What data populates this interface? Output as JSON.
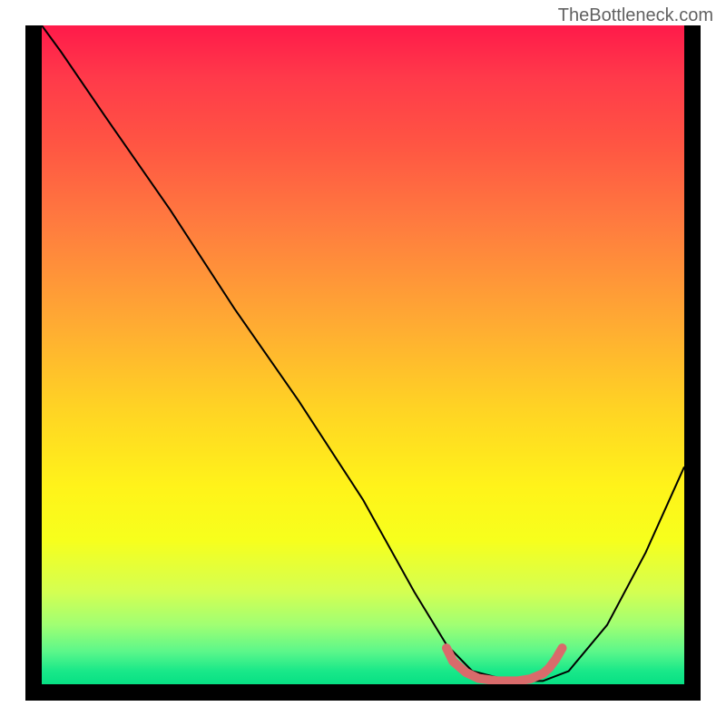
{
  "watermark": "TheBottleneck.com",
  "chart_data": {
    "type": "line",
    "title": "",
    "xlabel": "",
    "ylabel": "",
    "xlim": [
      0,
      100
    ],
    "ylim": [
      0,
      100
    ],
    "series": [
      {
        "name": "bottleneck-curve",
        "color": "#000000",
        "x": [
          0,
          3,
          10,
          20,
          30,
          40,
          50,
          58,
          63,
          67,
          73,
          78,
          82,
          88,
          94,
          100
        ],
        "y": [
          100,
          96,
          86,
          72,
          57,
          43,
          28,
          14,
          6,
          2,
          0.5,
          0.5,
          2,
          9,
          20,
          33
        ]
      },
      {
        "name": "minimum-highlight",
        "color": "#d96b6b",
        "x": [
          63,
          64,
          66,
          68,
          71,
          74,
          76,
          78,
          79,
          80,
          81
        ],
        "y": [
          5.5,
          3.5,
          1.8,
          0.9,
          0.5,
          0.5,
          0.8,
          1.6,
          2.5,
          3.8,
          5.5
        ]
      }
    ],
    "gradient_background": {
      "top_color": "#ff1a4a",
      "bottom_color": "#07e084"
    }
  }
}
